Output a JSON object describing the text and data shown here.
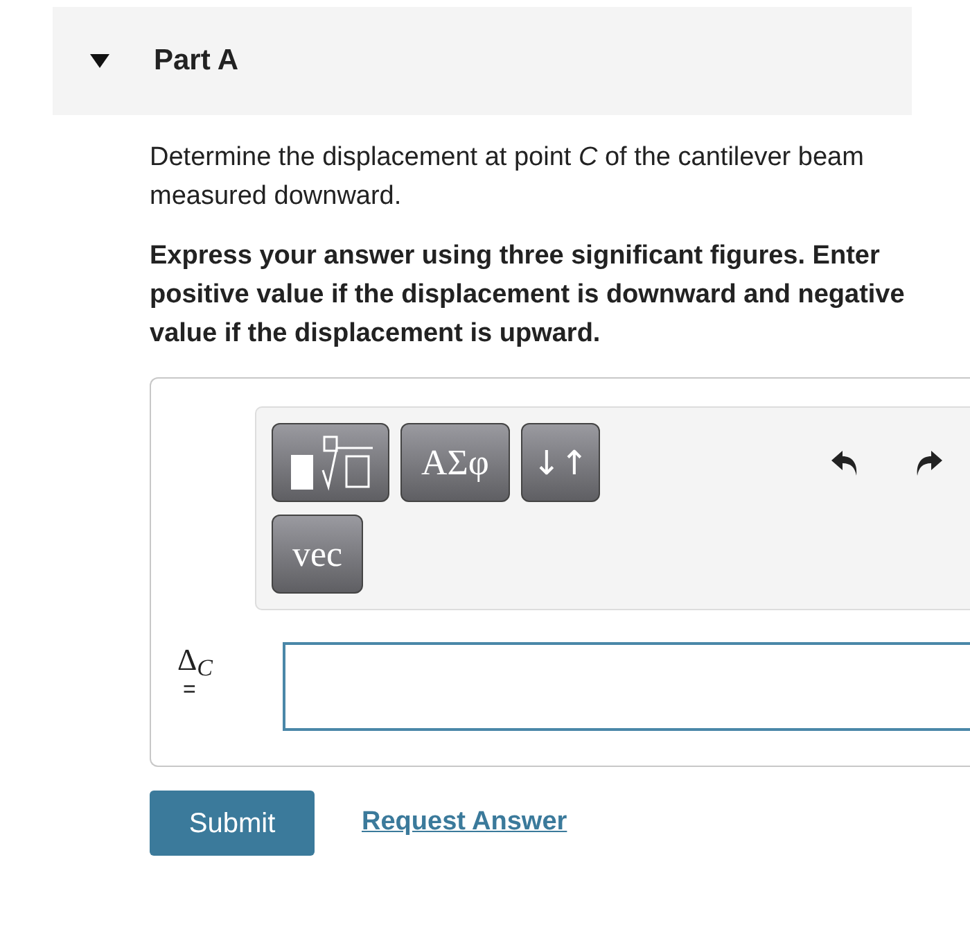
{
  "part": {
    "title": "Part A",
    "expanded": true
  },
  "question": "Determine the displacement at point *C* of the cantilever beam measured downward.",
  "instructions": "Express your answer using three significant figures. Enter positive value if the displacement is downward and negative value if the displacement is upward.",
  "toolbar": {
    "rows": [
      [
        {
          "kind": "template"
        },
        {
          "kind": "text",
          "label": "ΑΣφ"
        },
        {
          "kind": "text",
          "label": "↓↑"
        }
      ],
      [
        {
          "kind": "text",
          "label": "vec"
        }
      ]
    ],
    "actions": [
      {
        "kind": "undo"
      },
      {
        "kind": "redo"
      }
    ]
  },
  "answer": {
    "label": "Δ$_{C}$",
    "equals": "="
  },
  "buttons": {
    "submit": "Submit",
    "request": "Request Answer"
  }
}
